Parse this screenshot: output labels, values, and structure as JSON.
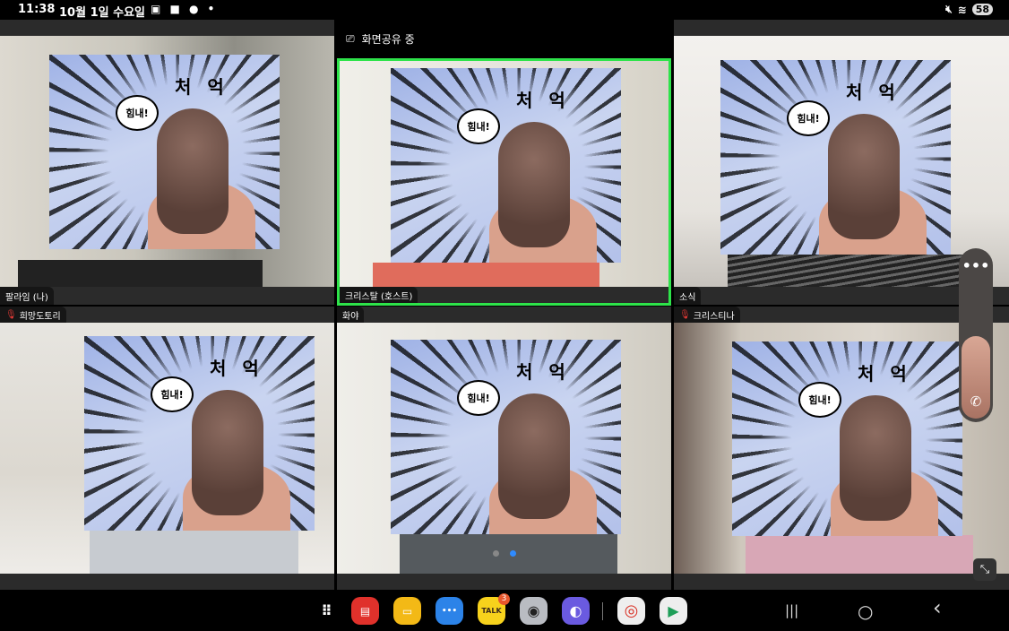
{
  "status_bar": {
    "time": "11:38",
    "date": "10월 1일 수요일",
    "notification_icons": "▣ ■ ●  •",
    "battery": "58"
  },
  "screen_share": {
    "label": "화면공유 중"
  },
  "meme": {
    "bubble": "힘내!",
    "sfx": "처억"
  },
  "participants": [
    {
      "name": "팔라임 (나)",
      "muted": false
    },
    {
      "name": "크리스탈 (호스트)",
      "muted": false,
      "active_speaker": true
    },
    {
      "name": "소식",
      "muted": false
    },
    {
      "name": "희망도토리",
      "muted": true
    },
    {
      "name": "화야",
      "muted": false
    },
    {
      "name": "크리스티나",
      "muted": true
    }
  ],
  "controls": {
    "more": "•••",
    "call": "✆",
    "minimize": "⤡"
  },
  "pagination": {
    "pages": 2,
    "current": 2
  },
  "dock": {
    "apps": [
      {
        "name": "app-drawer",
        "glyph": "⠿",
        "color": "#000000"
      },
      {
        "name": "notes",
        "glyph": "▤",
        "color": "#e0312b"
      },
      {
        "name": "my-files",
        "glyph": "▭",
        "color": "#f3b916"
      },
      {
        "name": "messages",
        "glyph": "•••",
        "color": "#2c83e8"
      },
      {
        "name": "kakaotalk",
        "glyph": "TALK",
        "color": "#f7d21c",
        "badge": "3"
      },
      {
        "name": "camera",
        "glyph": "◉",
        "color": "#b9bcc2"
      },
      {
        "name": "internet",
        "glyph": "◐",
        "color": "#6a5ae0"
      },
      {
        "name": "chrome",
        "glyph": "◎",
        "color": "#eeeeee"
      },
      {
        "name": "play-store",
        "glyph": "▶",
        "color": "#eeeeee"
      }
    ],
    "nav": {
      "recents": "|||",
      "home": "○",
      "back": "‹"
    }
  }
}
